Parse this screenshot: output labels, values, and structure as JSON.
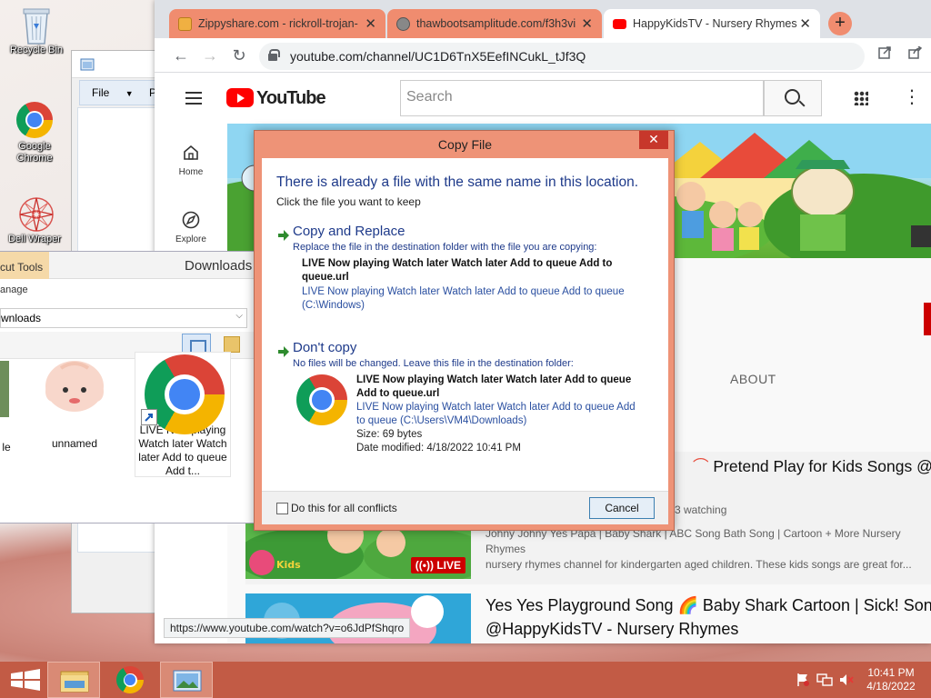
{
  "desktop": {
    "icons": [
      {
        "label": "Recycle Bin"
      },
      {
        "label": "Google Chrome"
      },
      {
        "label": "Dell Wraper"
      }
    ]
  },
  "explorer_back": {
    "file_tab": "File",
    "next_tab": "P"
  },
  "downloads_window": {
    "context_tab": "cut Tools",
    "title": "Downloads",
    "manage": "anage",
    "address": "wnloads",
    "files": [
      {
        "label": "le"
      },
      {
        "label": "unnamed"
      },
      {
        "label": "LIVE Now playing Watch later Watch later Add to queue Add t..."
      }
    ]
  },
  "browser": {
    "tabs": [
      {
        "title": "Zippyshare.com - rickroll-trojan-"
      },
      {
        "title": "thawbootsamplitude.com/f3h3vi"
      },
      {
        "title": "HappyKidsTV - Nursery Rhymes"
      }
    ],
    "url": "youtube.com/channel/UC1D6TnX5EefINCukL_tJf3Q",
    "status_url": "https://www.youtube.com/watch?v=o6JdPfShqro"
  },
  "youtube": {
    "search_placeholder": "Search",
    "guide": [
      {
        "label": "Home"
      },
      {
        "label": "Explore"
      }
    ],
    "about_tab": "ABOUT",
    "videos": [
      {
        "title": "Pretend Play for Kids Songs @Ha",
        "meta": "3 watching",
        "desc_1": "Johny Johny Yes Papa | Baby Shark | ABC Song Bath Song | Cartoon + More Nursery Rhymes",
        "desc_2": "nursery rhymes channel for kindergarten aged children. These kids songs are great for...",
        "badge": "LIVE"
      },
      {
        "title_1": "Yes Yes Playground Song 🌈 Baby Shark Cartoon | Sick! Song |",
        "title_2": "@HappyKidsTV - Nursery Rhymes"
      }
    ]
  },
  "dialog": {
    "title": "Copy File",
    "close": "✕",
    "heading": "There is already a file with the same name in this location.",
    "subheading": "Click the file you want to keep",
    "option_replace": {
      "head": "Copy and Replace",
      "desc": "Replace the file in the destination folder with the file you are copying:",
      "name_1": "LIVE Now playing Watch later Watch later Add to queue Add to",
      "name_2": "queue.url",
      "path_1": "LIVE Now playing Watch later Watch later Add to queue Add to queue",
      "path_2": "(C:\\Windows)"
    },
    "option_keep": {
      "head": "Don't copy",
      "desc": "No files will be changed. Leave this file in the destination folder:",
      "name_1": "LIVE Now playing Watch later Watch later Add to queue",
      "name_2": "Add to queue.url",
      "path_1": "LIVE Now playing Watch later Watch later Add to queue Add",
      "path_2": "to queue (C:\\Users\\VM4\\Downloads)",
      "size": "Size: 69 bytes",
      "modified": "Date modified: 4/18/2022 10:41 PM"
    },
    "checkbox_label": "Do this for all conflicts",
    "cancel": "Cancel"
  },
  "taskbar": {
    "time": "10:41 PM",
    "date": "4/18/2022"
  },
  "colors": {
    "accent": "#ee9377",
    "taskbar": "#c25b45",
    "youtube_red": "#ff0000"
  }
}
